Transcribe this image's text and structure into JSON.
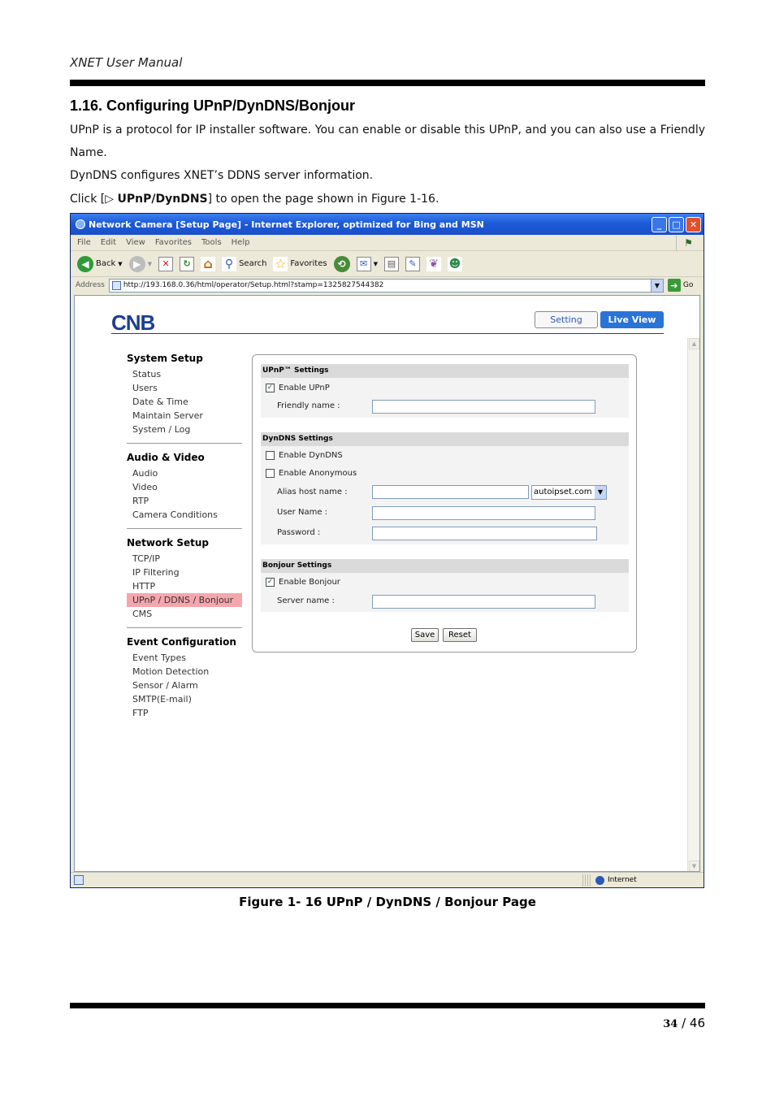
{
  "document": {
    "header": "XNET User Manual",
    "section_title": "1.16. Configuring UPnP/DynDNS/Bonjour",
    "para1": "UPnP is a protocol for IP installer software. You can enable or disable this UPnP, and you can also use a Friendly Name.",
    "para2": "DynDNS configures XNET’s DDNS server information.",
    "para3_prefix": "Click [",
    "para3_glyph": "▷",
    "para3_bold": "UPnP/DynDNS",
    "para3_suffix": "] to open the page shown in Figure 1-16.",
    "caption": "Figure 1- 16 UPnP / DynDNS / Bonjour Page",
    "page_current": "34",
    "page_sep": " / ",
    "page_total": "46"
  },
  "browser": {
    "title": "Network Camera [Setup Page] - Internet Explorer, optimized for Bing and MSN",
    "menu": [
      "File",
      "Edit",
      "View",
      "Favorites",
      "Tools",
      "Help"
    ],
    "toolbar": {
      "back": "Back",
      "search": "Search",
      "favorites": "Favorites"
    },
    "address_label": "Address",
    "address_url": "http://193.168.0.36/html/operator/Setup.html?stamp=1325827544382",
    "go_label": "Go",
    "status_zone": "Internet"
  },
  "camera": {
    "logo": "CNB",
    "tab_setting": "Setting",
    "tab_liveview": "Live View",
    "nav": [
      {
        "head": "System Setup",
        "items": [
          "Status",
          "Users",
          "Date & Time",
          "Maintain Server",
          "System / Log"
        ]
      },
      {
        "head": "Audio & Video",
        "items": [
          "Audio",
          "Video",
          "RTP",
          "Camera Conditions"
        ]
      },
      {
        "head": "Network Setup",
        "items": [
          "TCP/IP",
          "IP Filtering",
          "HTTP",
          "UPnP / DDNS / Bonjour",
          "CMS"
        ]
      },
      {
        "head": "Event Configuration",
        "items": [
          "Event Types",
          "Motion Detection",
          "Sensor / Alarm",
          "SMTP(E-mail)",
          "FTP"
        ]
      }
    ],
    "upnp": {
      "heading": "UPnP™ Settings",
      "enable_label": "Enable UPnP",
      "enable_checked": true,
      "friendly_label": "Friendly name :",
      "friendly_value": ""
    },
    "dyndns": {
      "heading": "DynDNS Settings",
      "enable_label": "Enable DynDNS",
      "enable_checked": false,
      "anon_label": "Enable Anonymous",
      "anon_checked": false,
      "alias_label": "Alias host name :",
      "alias_value": "",
      "domain_selected": "autoipset.com",
      "username_label": "User Name :",
      "password_label": "Password :"
    },
    "bonjour": {
      "heading": "Bonjour Settings",
      "enable_label": "Enable Bonjour",
      "enable_checked": true,
      "server_label": "Server name :",
      "server_value": ""
    },
    "save_label": "Save",
    "reset_label": "Reset"
  },
  "colors": {
    "titlebar": "#1c5ad8",
    "nav_active": "#f5a6ad",
    "liveview_tab": "#2a74d8",
    "logo": "#1c3f8f"
  }
}
